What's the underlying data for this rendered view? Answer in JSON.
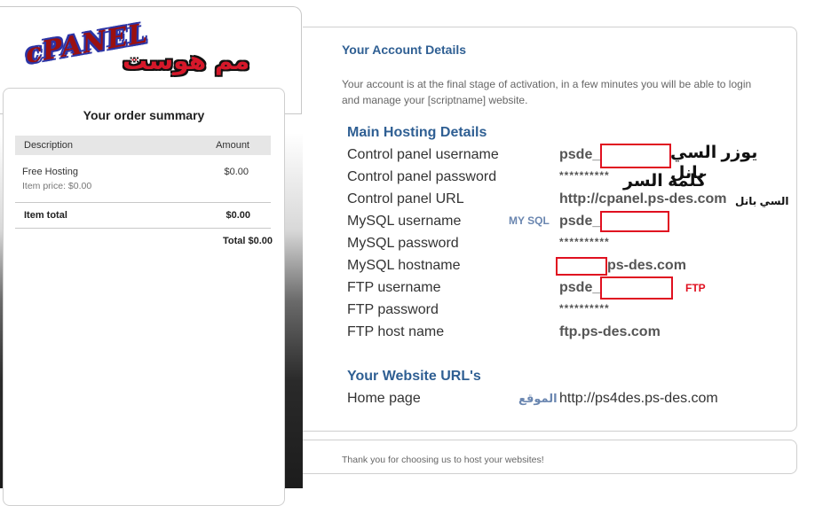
{
  "logo": {
    "cpanel_text": "cPANEL",
    "arabic_text": "مم هوست"
  },
  "order_summary": {
    "title": "Your order summary",
    "col_description": "Description",
    "col_amount": "Amount",
    "item_name": "Free Hosting",
    "item_price_label": "Item price: $0.00",
    "item_amount": "$0.00",
    "item_total_label": "Item total",
    "item_total_value": "$0.00",
    "grand_total": "Total $0.00"
  },
  "account": {
    "title": "Your Account Details",
    "intro": "Your account is at the final stage of activation, in a few minutes you will be able to login and manage your [scriptname] website."
  },
  "hosting": {
    "title": "Main Hosting Details",
    "rows": [
      {
        "label": "Control panel username",
        "value": "psde_"
      },
      {
        "label": "Control panel password",
        "value": "**********"
      },
      {
        "label": "Control panel URL",
        "value": "http://cpanel.ps-des.com"
      },
      {
        "label": "MySQL username",
        "value": "psde_"
      },
      {
        "label": "MySQL password",
        "value": "**********"
      },
      {
        "label": "MySQL hostname",
        "value": "ps-des.com"
      },
      {
        "label": "FTP username",
        "value": "psde_"
      },
      {
        "label": "FTP password",
        "value": "**********"
      },
      {
        "label": "FTP host name",
        "value": "ftp.ps-des.com"
      }
    ]
  },
  "website": {
    "title": "Your Website URL's",
    "home_label": "Home page",
    "home_value": "http://ps4des.ps-des.com"
  },
  "annotations": {
    "cpanel_user": "يوزر السي بانل",
    "password": "كلمة السر",
    "cpanel": "السي بانل",
    "mysql": "MY SQL",
    "ftp": "FTP",
    "site": "الموقع"
  },
  "footer": {
    "text": "Thank you for choosing us to host your websites!"
  },
  "colors": {
    "heading_blue": "#2f5f93",
    "annotation_red": "#e01020"
  }
}
